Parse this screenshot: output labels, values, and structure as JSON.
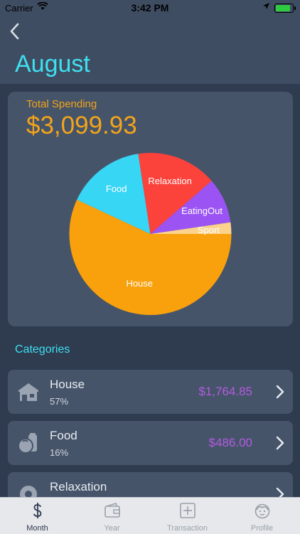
{
  "status_bar": {
    "carrier": "Carrier",
    "time": "3:42 PM"
  },
  "header": {
    "title": "August"
  },
  "summary": {
    "label": "Total Spending",
    "value": "$3,099.93"
  },
  "chart_data": {
    "type": "pie",
    "labels": [
      "House",
      "Food",
      "Relaxation",
      "EatingOut",
      "Sport"
    ],
    "values": [
      1764.85,
      486.0,
      497.0,
      281.0,
      71.08
    ],
    "colors": [
      "#f9a10c",
      "#38d6f5",
      "#fb423b",
      "#9b54f3",
      "#fbd38c"
    ]
  },
  "categories_section": {
    "title": "Categories"
  },
  "categories": [
    {
      "name": "House",
      "percent": "57%",
      "amount": "$1,764.85",
      "icon": "house-icon"
    },
    {
      "name": "Food",
      "percent": "16%",
      "amount": "$486.00",
      "icon": "food-icon"
    },
    {
      "name": "Relaxation",
      "percent": "",
      "amount": "",
      "icon": "relaxation-icon"
    }
  ],
  "tabs": [
    {
      "label": "Month",
      "icon": "dollar-icon",
      "active": true
    },
    {
      "label": "Year",
      "icon": "wallet-icon",
      "active": false
    },
    {
      "label": "Transaction",
      "icon": "plus-square-icon",
      "active": false
    },
    {
      "label": "Profile",
      "icon": "face-icon",
      "active": false
    }
  ]
}
